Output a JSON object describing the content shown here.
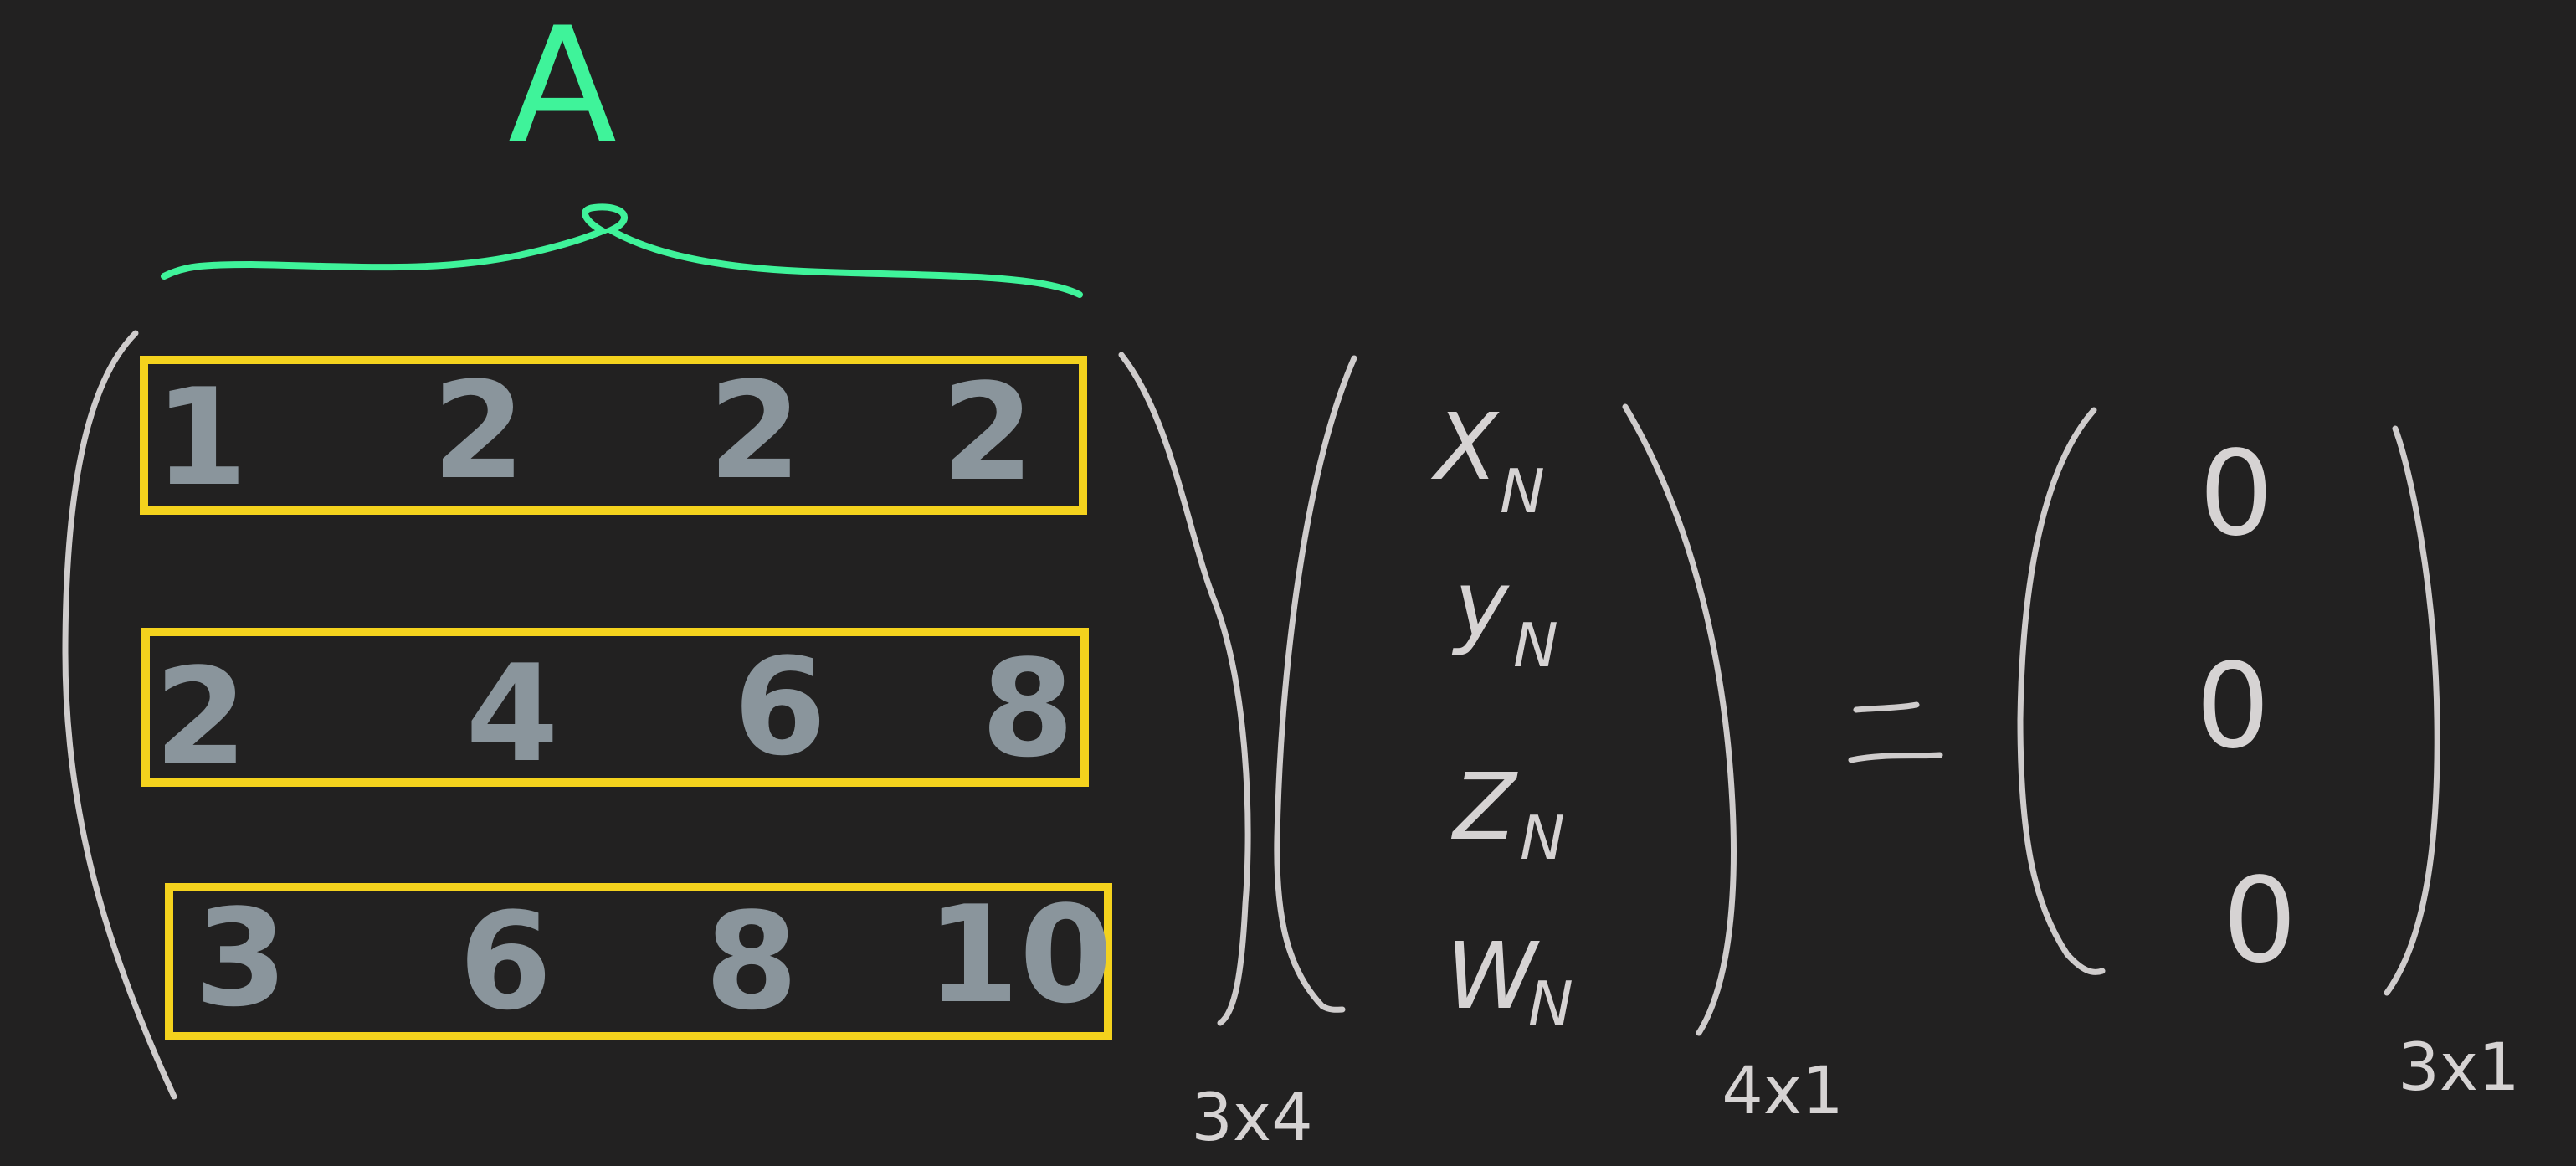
{
  "diagram": {
    "matrix_label": "A",
    "matrix_rows": [
      [
        "1",
        "2",
        "2",
        "2"
      ],
      [
        "2",
        "4",
        "6",
        "8"
      ],
      [
        "3",
        "6",
        "8",
        "10"
      ]
    ],
    "vector_vars": [
      {
        "var": "X",
        "sub": "N"
      },
      {
        "var": "y",
        "sub": "N"
      },
      {
        "var": "Z",
        "sub": "N"
      },
      {
        "var": "W",
        "sub": "N"
      }
    ],
    "equals": "=",
    "result_values": [
      "0",
      "0",
      "0"
    ],
    "dims": {
      "matrix": "3x4",
      "vector": "4x1",
      "result": "3x1"
    },
    "colors": {
      "background": "#222121",
      "ink": "#d6d3d3",
      "matrix_entries": "#8a959c",
      "row_highlight": "#f4d21d",
      "label_accent": "#3ff39a"
    }
  }
}
